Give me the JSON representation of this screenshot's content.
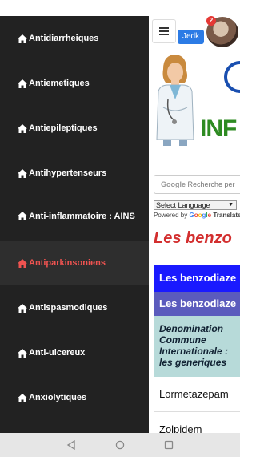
{
  "drawer": {
    "items": [
      {
        "label": "Antidiarrheiques",
        "active": false
      },
      {
        "label": "Antiemetiques",
        "active": false
      },
      {
        "label": "Antiepileptiques",
        "active": false
      },
      {
        "label": "Antihypertenseurs",
        "active": false
      },
      {
        "label": "Anti-inflammatoire : AINS",
        "active": false
      },
      {
        "label": "Antiparkinsoniens",
        "active": true
      },
      {
        "label": "Antispasmodiques",
        "active": false
      },
      {
        "label": "Anti-ulcereux",
        "active": false
      },
      {
        "label": "Anxiolytiques",
        "active": false
      }
    ],
    "icon": "home-icon",
    "active_color": "#ef5350"
  },
  "header": {
    "user_chip": "Jedk",
    "notification_count": "2"
  },
  "banner": {
    "logo_text": "INF"
  },
  "search": {
    "google_label": "Google",
    "placeholder": "Recherche per"
  },
  "translate": {
    "select_label": "Select Language",
    "powered_prefix": "Powered by",
    "powered_brand": "Google",
    "powered_suffix": "Translate"
  },
  "content": {
    "heading": "Les benzo",
    "table": {
      "row1": "Les benzodiaze",
      "row2": "Les benzodiaze",
      "row3_lines": [
        "Denomination",
        "Commune",
        "Internationale :",
        "les generiques"
      ],
      "rows": [
        "Lormetazepam",
        "Zolpidem"
      ]
    }
  }
}
